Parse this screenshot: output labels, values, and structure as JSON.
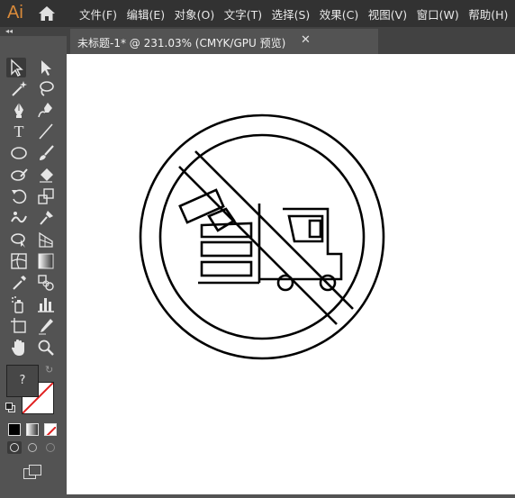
{
  "app": {
    "logo_text": "Ai"
  },
  "menu": {
    "items": [
      "文件(F)",
      "编辑(E)",
      "对象(O)",
      "文字(T)",
      "选择(S)",
      "效果(C)",
      "视图(V)",
      "窗口(W)",
      "帮助(H)"
    ]
  },
  "tab": {
    "title": "未标题-1* @ 231.03% (CMYK/GPU 预览)"
  },
  "colors": {
    "panel": "#535353",
    "menubar": "#323232",
    "tabbar": "#424242",
    "logo": "#d98a3a",
    "canvas": "#ffffff",
    "stroke": "#000000",
    "none_swatch": "#e02020"
  },
  "toolbox": {
    "tools": [
      "selection-tool",
      "direct-selection-tool",
      "magic-wand-tool",
      "lasso-tool",
      "pen-tool",
      "curvature-tool",
      "type-tool",
      "line-segment-tool",
      "ellipse-tool",
      "paintbrush-tool",
      "shaper-tool",
      "eraser-tool",
      "rotate-tool",
      "scale-tool",
      "width-tool",
      "puppet-warp-tool",
      "shape-builder-tool",
      "perspective-grid-tool",
      "mesh-tool",
      "gradient-tool",
      "eyedropper-tool",
      "blend-tool",
      "symbol-sprayer-tool",
      "column-graph-tool",
      "artboard-tool",
      "slice-tool",
      "hand-tool",
      "zoom-tool"
    ],
    "fill_placeholder": "?"
  }
}
